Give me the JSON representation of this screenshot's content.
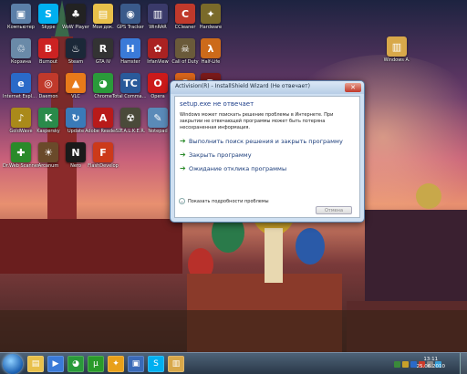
{
  "desktop": {
    "icons": [
      {
        "label": "Компьютер",
        "color": "#5b7fa8",
        "glyph": "▣"
      },
      {
        "label": "Skype",
        "color": "#00aff0",
        "glyph": "S"
      },
      {
        "label": "WoW Player",
        "color": "#222222",
        "glyph": "♣"
      },
      {
        "label": "Мои док.",
        "color": "#e8c04a",
        "glyph": "▤"
      },
      {
        "label": "GPS Tracker",
        "color": "#3a5a8a",
        "glyph": "◉"
      },
      {
        "label": "WinRAR",
        "color": "#3a3a6a",
        "glyph": "▥"
      },
      {
        "label": "CCleaner",
        "color": "#c0392b",
        "glyph": "C"
      },
      {
        "label": "Hardware",
        "color": "#7a6a2a",
        "glyph": "✦"
      },
      {
        "label": "Корзина",
        "color": "#6a8aa8",
        "glyph": "♲"
      },
      {
        "label": "Burnout",
        "color": "#cc2222",
        "glyph": "B"
      },
      {
        "label": "Steam",
        "color": "#1b2838",
        "glyph": "♨"
      },
      {
        "label": "GTA IV",
        "color": "#333333",
        "glyph": "R"
      },
      {
        "label": "Hamster",
        "color": "#3a7ad8",
        "glyph": "H"
      },
      {
        "label": "IrfanView",
        "color": "#aa2222",
        "glyph": "✿"
      },
      {
        "label": "Call of Duty",
        "color": "#6a5a3a",
        "glyph": "☠"
      },
      {
        "label": "Half-Life",
        "color": "#cc6a1a",
        "glyph": "λ"
      },
      {
        "label": "Internet Explorer",
        "color": "#2a6ac8",
        "glyph": "e"
      },
      {
        "label": "Daemon",
        "color": "#c0392b",
        "glyph": "◎"
      },
      {
        "label": "VLC",
        "color": "#e87a1a",
        "glyph": "▲"
      },
      {
        "label": "Chrome",
        "color": "#2a9a3a",
        "glyph": "◕"
      },
      {
        "label": "Total Commander",
        "color": "#2a5a9a",
        "glyph": "TC"
      },
      {
        "label": "Opera",
        "color": "#cc1a1a",
        "glyph": "O"
      },
      {
        "label": "Firefox",
        "color": "#d8641a",
        "glyph": "ʘ"
      },
      {
        "label": "Dota",
        "color": "#7a1a1a",
        "glyph": "D"
      },
      {
        "label": "GoldWave",
        "color": "#aa8a1a",
        "glyph": "♪"
      },
      {
        "label": "Kaspersky",
        "color": "#2a8a4a",
        "glyph": "K"
      },
      {
        "label": "Update",
        "color": "#3a7ab8",
        "glyph": "↻"
      },
      {
        "label": "Adobe Reader 9",
        "color": "#b81a1a",
        "glyph": "A"
      },
      {
        "label": "S.T.A.L.K.E.R.",
        "color": "#4a4a3a",
        "glyph": "☢"
      },
      {
        "label": "Notepad",
        "color": "#5a8ab8",
        "glyph": "✎"
      },
      {
        "label": "Инфинити",
        "color": "#6a4a8a",
        "glyph": "∞"
      },
      {
        "label": "Autorun",
        "color": "#3a6a3a",
        "glyph": "A"
      },
      {
        "label": "Dr.Web Scanner",
        "color": "#2a8a2a",
        "glyph": "✚"
      },
      {
        "label": "Arcanum",
        "color": "#6a4a2a",
        "glyph": "☀"
      },
      {
        "label": "Nero",
        "color": "#1a1a1a",
        "glyph": "N"
      },
      {
        "label": "FlashDevelop",
        "color": "#cc3a1a",
        "glyph": "F"
      },
      {
        "label": "Windows A.",
        "color": "#d8a84a",
        "glyph": "▥"
      }
    ]
  },
  "dialog": {
    "title": "Activision(R) - InstallShield Wizard (Не отвечает)",
    "heading": "setup.exe не отвечает",
    "message": "Windows может поискать решение проблемы в Интернете. При закрытии не отвечающей программы может быть потеряна несохраненная информация.",
    "options": [
      "Выполнить поиск решения и закрыть программу",
      "Закрыть программу",
      "Ожидание отклика программы"
    ],
    "details_label": "Показать подробности проблемы",
    "cancel_label": "Отмена",
    "close_glyph": "✕"
  },
  "taskbar": {
    "buttons": [
      {
        "name": "explorer",
        "color": "#e8c04a",
        "glyph": "▤"
      },
      {
        "name": "player",
        "color": "#3a7ad8",
        "glyph": "▶"
      },
      {
        "name": "chrome",
        "color": "#2a9a3a",
        "glyph": "◕"
      },
      {
        "name": "utorrent",
        "color": "#2a9a2a",
        "glyph": "µ"
      },
      {
        "name": "winamp",
        "color": "#e8a01a",
        "glyph": "✦"
      },
      {
        "name": "installer",
        "color": "#3a6ab8",
        "glyph": "▣"
      },
      {
        "name": "skype",
        "color": "#00aff0",
        "glyph": "S"
      },
      {
        "name": "folder",
        "color": "#d8a84a",
        "glyph": "▥"
      }
    ],
    "time": "13:11",
    "date": "25.06.2010"
  }
}
